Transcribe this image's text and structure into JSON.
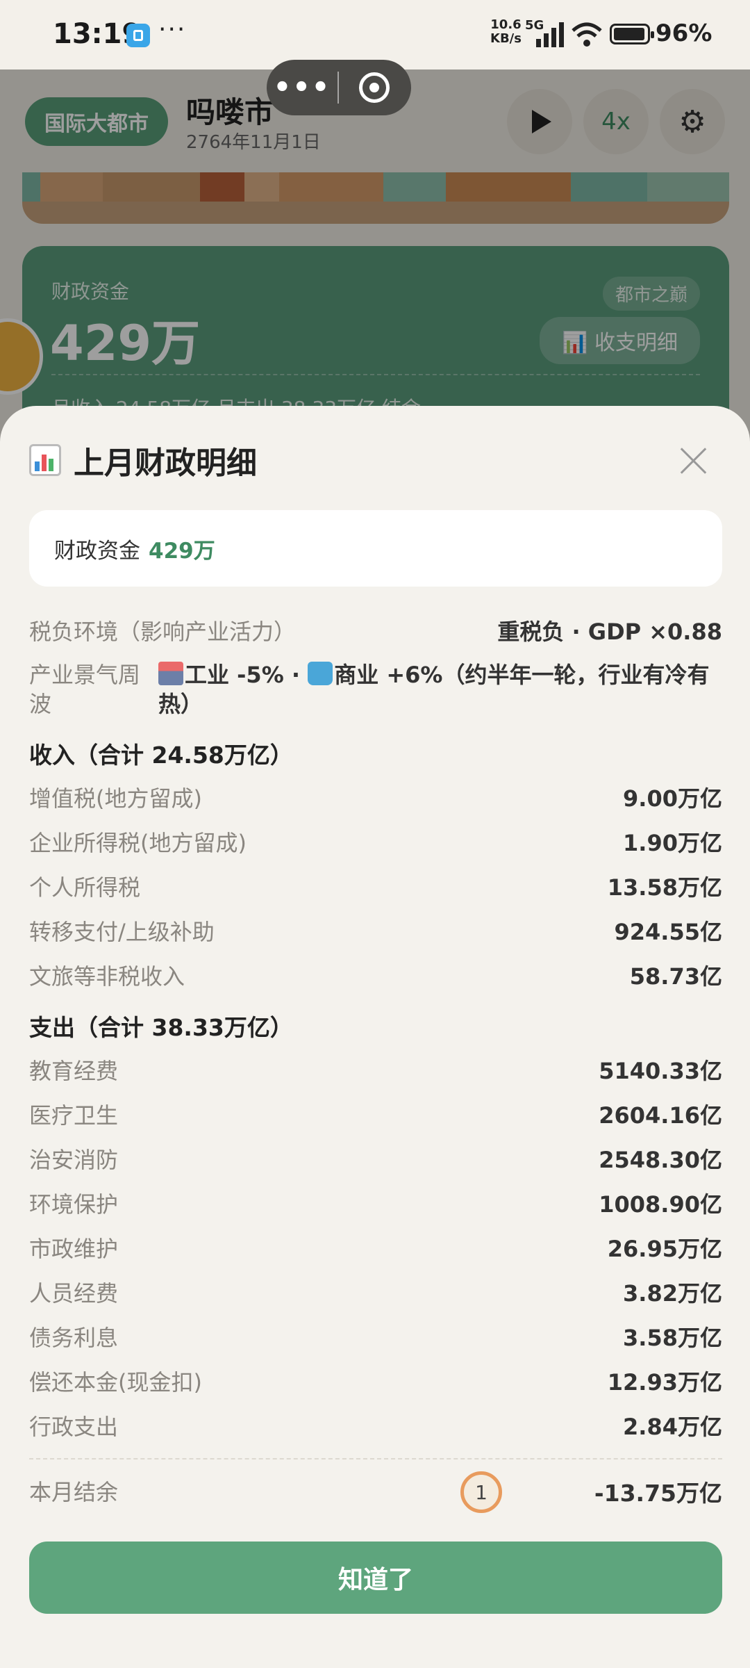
{
  "status_bar": {
    "time": "13:19",
    "net_speed_value": "10.6",
    "net_speed_unit": "KB/s",
    "network": "5G",
    "battery": "96%"
  },
  "capsule": {
    "more_icon": "more-dots-icon",
    "close_icon": "target-close-icon"
  },
  "background_app": {
    "city_badge": "国际大都市",
    "city_name": "吗喽市",
    "date": "2764年11月1日",
    "speed_label": "4x",
    "finance_card": {
      "label": "财政资金",
      "value": "429万",
      "tag": "都市之巅",
      "detail_button": "📊 收支明细",
      "summary_strip": "月收入 24.58万亿   月支出 38.33万亿   结余"
    }
  },
  "sheet": {
    "title": "上月财政明细",
    "fund_label": "财政资金",
    "fund_value": "429万",
    "tax_env_label": "税负环境（影响产业活力）",
    "tax_env_value": "重税负 · GDP ×0.88",
    "wave_label": "产业景气周波",
    "wave_value_industry": "工业 -5% · ",
    "wave_value_commerce": "商业 +6%（约半年一轮，行业有冷有热）",
    "income_header": "收入（合计 24.58万亿）",
    "income": [
      {
        "label": "增值税(地方留成)",
        "value": "9.00万亿"
      },
      {
        "label": "企业所得税(地方留成)",
        "value": "1.90万亿"
      },
      {
        "label": "个人所得税",
        "value": "13.58万亿"
      },
      {
        "label": "转移支付/上级补助",
        "value": "924.55亿"
      },
      {
        "label": "文旅等非税收入",
        "value": "58.73亿"
      }
    ],
    "expense_header": "支出（合计 38.33万亿）",
    "expenses": [
      {
        "label": "教育经费",
        "value": "5140.33亿"
      },
      {
        "label": "医疗卫生",
        "value": "2604.16亿"
      },
      {
        "label": "治安消防",
        "value": "2548.30亿"
      },
      {
        "label": "环境保护",
        "value": "1008.90亿"
      },
      {
        "label": "市政维护",
        "value": "26.95万亿"
      },
      {
        "label": "人员经费",
        "value": "3.82万亿"
      },
      {
        "label": "债务利息",
        "value": "3.58万亿"
      },
      {
        "label": "偿还本金(现金扣)",
        "value": "12.93万亿"
      },
      {
        "label": "行政支出",
        "value": "2.84万亿"
      }
    ],
    "balance_label": "本月结余",
    "marker_number": "1",
    "balance_value": "-13.75万亿",
    "confirm_button": "知道了"
  }
}
